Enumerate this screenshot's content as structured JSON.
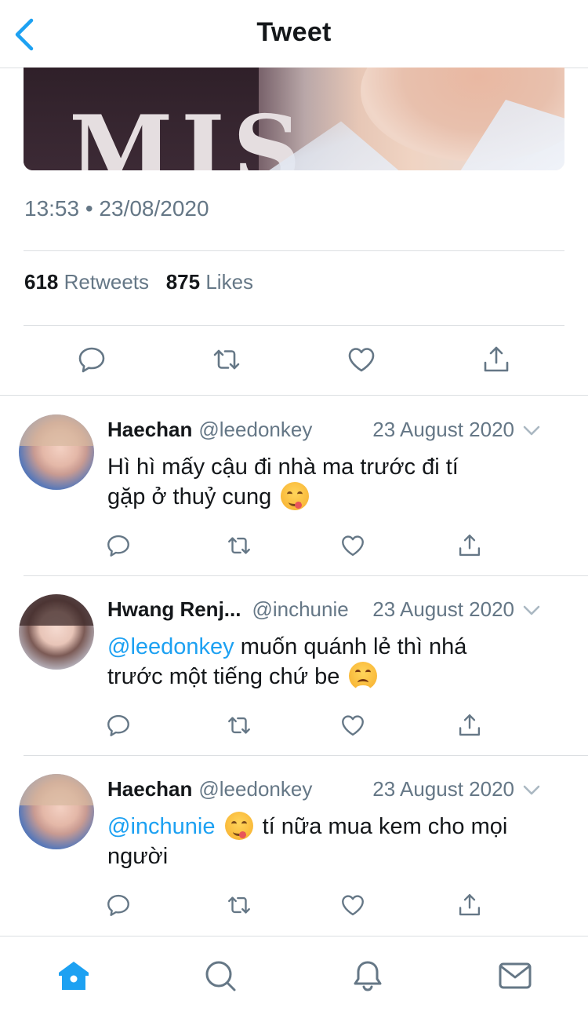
{
  "header": {
    "title": "Tweet"
  },
  "tweet": {
    "timestamp": "13:53 • 23/08/2020",
    "retweets_count": "618",
    "retweets_label": "Retweets",
    "likes_count": "875",
    "likes_label": "Likes"
  },
  "media": {
    "shirt_text": "MIS"
  },
  "replies": [
    {
      "name": "Haechan",
      "handle": "@leedonkey",
      "date": "23 August 2020",
      "mention": "",
      "text_line1": "Hì hì mấy cậu đi nhà ma trước đi tí",
      "text_line2": "gặp ở thuỷ cung",
      "emoji": "face-savoring-food"
    },
    {
      "name": "Hwang Renj...",
      "handle": "@inchunie",
      "date": "23 August 2020",
      "mention": "@leedonkey",
      "text_line1": " muốn quánh lẻ thì nhá",
      "text_line2": "trước một tiếng chứ be",
      "emoji": "face-with-steam-from-nose"
    },
    {
      "name": "Haechan",
      "handle": "@leedonkey",
      "date": "23 August 2020",
      "mention": "@inchunie",
      "text_line1": " tí nữa mua kem cho mọi",
      "text_line2": "người",
      "emoji": "face-savoring-food"
    }
  ],
  "icons": {
    "reply": "reply-icon",
    "retweet": "retweet-icon",
    "like": "heart-icon",
    "share": "share-icon",
    "home": "home-icon",
    "search": "search-icon",
    "notifications": "bell-icon",
    "messages": "mail-icon"
  },
  "colors": {
    "accent": "#1da1f2",
    "secondary_text": "#657786",
    "divider": "#dcdfe2"
  }
}
